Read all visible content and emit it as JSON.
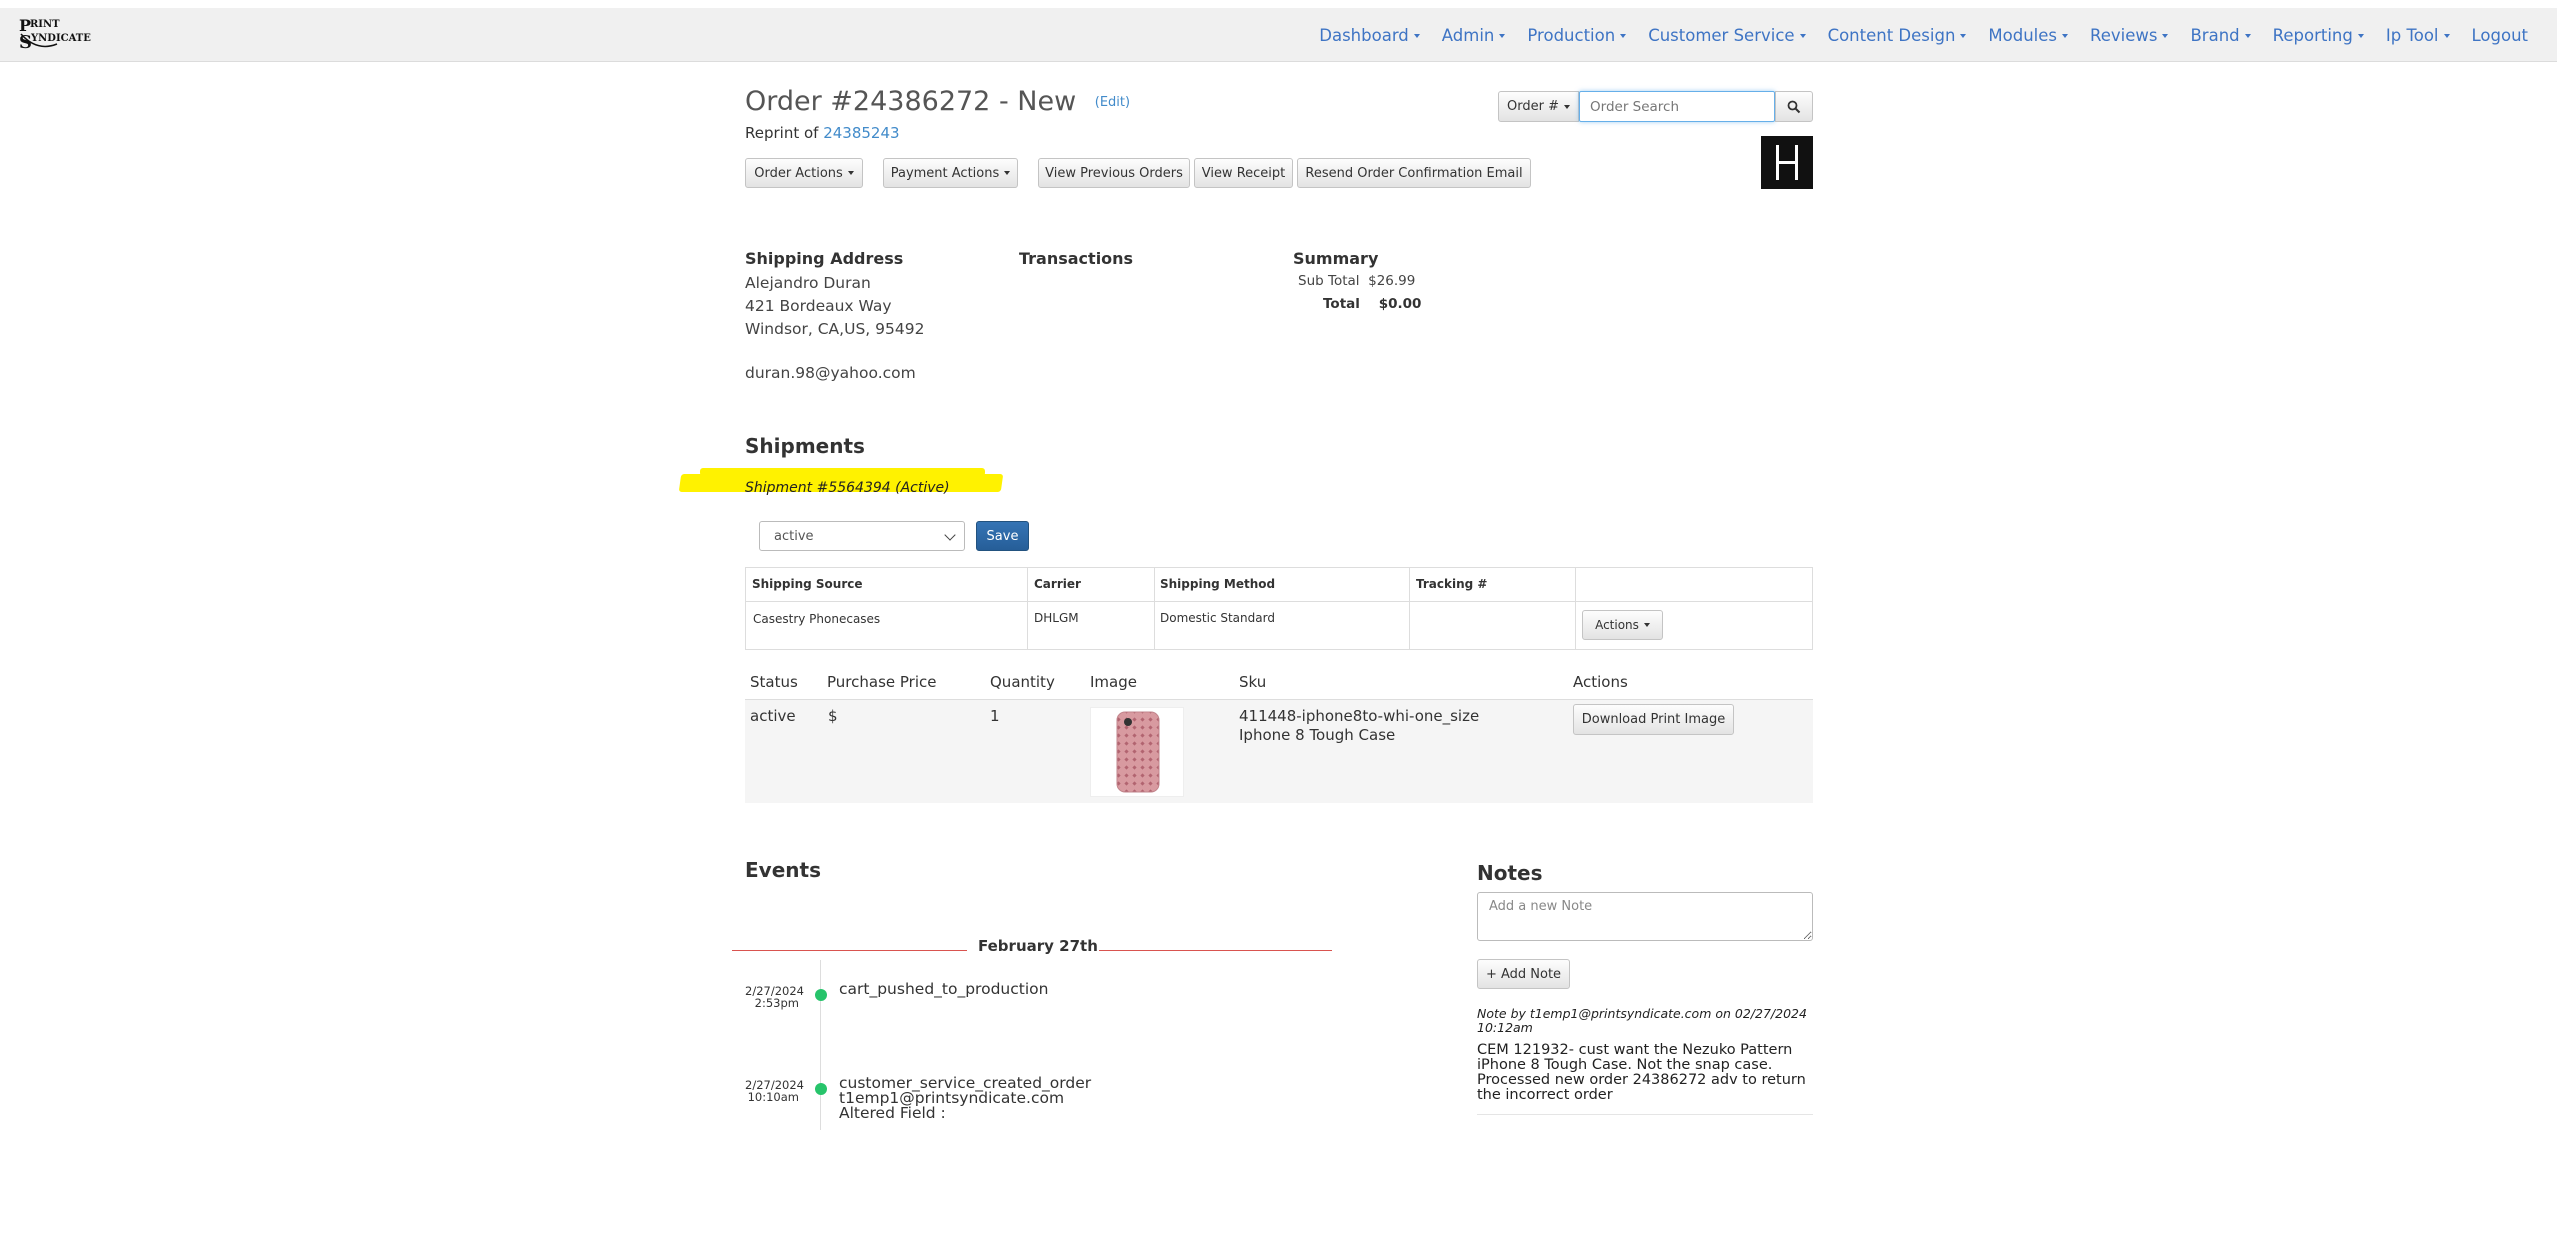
{
  "nav": {
    "brand_text": "PRINT SYNDICATE",
    "items": [
      {
        "label": "Dashboard",
        "dropdown": true
      },
      {
        "label": "Admin",
        "dropdown": true
      },
      {
        "label": "Production",
        "dropdown": true
      },
      {
        "label": "Customer Service",
        "dropdown": true
      },
      {
        "label": "Content Design",
        "dropdown": true
      },
      {
        "label": "Modules",
        "dropdown": true
      },
      {
        "label": "Reviews",
        "dropdown": true
      },
      {
        "label": "Brand",
        "dropdown": true
      },
      {
        "label": "Reporting",
        "dropdown": true
      },
      {
        "label": "Ip Tool",
        "dropdown": true
      },
      {
        "label": "Logout",
        "dropdown": false
      }
    ]
  },
  "order": {
    "title": "Order #24386272 - New",
    "edit_label": "(Edit)",
    "reprint_prefix": "Reprint of ",
    "reprint_link": "24385243"
  },
  "search": {
    "type_label": "Order #",
    "placeholder": "Order Search"
  },
  "actions": {
    "order_actions": "Order Actions",
    "payment_actions": "Payment Actions",
    "view_previous_orders": "View Previous Orders",
    "view_receipt": "View Receipt",
    "resend_confirmation": "Resend Order Confirmation Email"
  },
  "shipping_address": {
    "heading": "Shipping Address",
    "name": "Alejandro Duran",
    "street": "421 Bordeaux Way",
    "city_line": "Windsor, CA,US, 95492",
    "email": "duran.98@yahoo.com"
  },
  "transactions": {
    "heading": "Transactions"
  },
  "summary": {
    "heading": "Summary",
    "subtotal_label": "Sub Total",
    "subtotal_value": "$26.99",
    "total_label": "Total",
    "total_value": "$0.00"
  },
  "shipments": {
    "heading": "Shipments",
    "shipment_label": "Shipment #5564394 (Active)",
    "status_value": "active",
    "save_label": "Save",
    "table": {
      "headers": [
        "Shipping Source",
        "Carrier",
        "Shipping Method",
        "Tracking #",
        ""
      ],
      "row": [
        "Casestry Phonecases",
        "DHLGM",
        "Domestic Standard",
        ""
      ],
      "actions_label": "Actions"
    }
  },
  "items": {
    "headers": [
      "Status",
      "Purchase Price",
      "Quantity",
      "Image",
      "Sku",
      "Actions"
    ],
    "rows": [
      {
        "status": "active",
        "price": "$",
        "quantity": "1",
        "sku": "411448-iphone8to-whi-one_size",
        "product": "Iphone 8 Tough Case",
        "action_label": "Download Print Image"
      }
    ]
  },
  "events": {
    "heading": "Events",
    "date_header": "February 27th",
    "list": [
      {
        "date": "2/27/2024",
        "time": "2:53pm",
        "text": "cart_pushed_to_production",
        "extra": []
      },
      {
        "date": "2/27/2024",
        "time": "10:10am",
        "text": "customer_service_created_order",
        "extra": [
          "t1emp1@printsyndicate.com",
          "Altered Field :"
        ]
      }
    ]
  },
  "notes": {
    "heading": "Notes",
    "placeholder": "Add a new Note",
    "add_label": "+ Add Note",
    "meta": "Note by t1emp1@printsyndicate.com on 02/27/2024 10:12am",
    "body": "CEM 121932- cust want the Nezuko Pattern iPhone 8 Tough Case. Not the snap case. Processed new order 24386272 adv to return the incorrect order"
  },
  "colors": {
    "link": "#428bca",
    "primary": "#2c6aa8",
    "highlight": "#fff200",
    "event_dot": "#27c46b",
    "date_rule": "#d9534f"
  }
}
